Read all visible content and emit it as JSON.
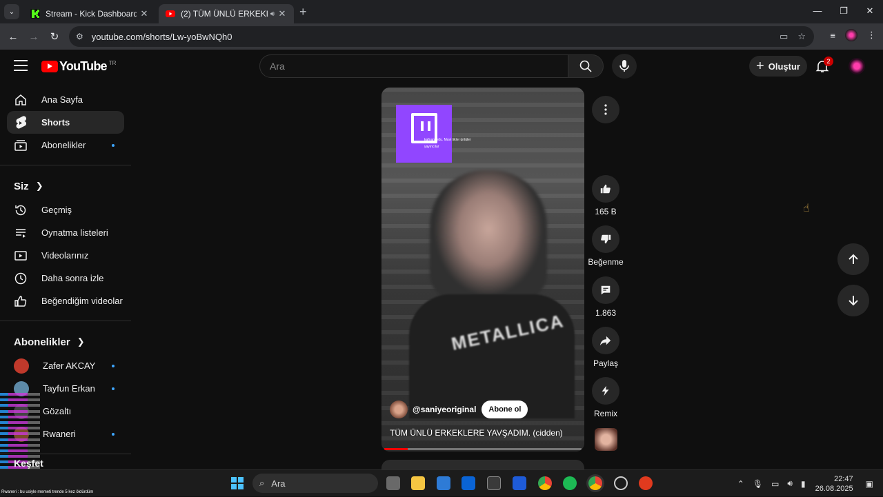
{
  "browser": {
    "tabs": [
      {
        "title": "Stream - Kick Dashboard",
        "active": false,
        "favicon": "kick-logo-icon"
      },
      {
        "title": "(2) TÜM ÜNLÜ ERKEKLERE Y",
        "active": true,
        "favicon": "youtube-icon",
        "audio": true
      }
    ],
    "url": "youtube.com/shorts/Lw-yoBwNQh0"
  },
  "youtube": {
    "logo_text": "YouTube",
    "region": "TR",
    "search_placeholder": "Ara",
    "create_label": "Oluştur",
    "notification_count": "2"
  },
  "sidebar": {
    "main": [
      {
        "label": "Ana Sayfa",
        "icon": "home-icon"
      },
      {
        "label": "Shorts",
        "icon": "shorts-icon",
        "active": true
      },
      {
        "label": "Abonelikler",
        "icon": "subscriptions-icon",
        "dot": true
      }
    ],
    "you_header": "Siz",
    "you": [
      {
        "label": "Geçmiş",
        "icon": "history-icon"
      },
      {
        "label": "Oynatma listeleri",
        "icon": "playlists-icon"
      },
      {
        "label": "Videolarınız",
        "icon": "your-videos-icon"
      },
      {
        "label": "Daha sonra izle",
        "icon": "watch-later-icon"
      },
      {
        "label": "Beğendiğim videolar",
        "icon": "liked-videos-icon"
      }
    ],
    "subs_header": "Abonelikler",
    "subs": [
      {
        "label": "Zafer AKCAY",
        "dot": true,
        "color": "#c0392b"
      },
      {
        "label": "Tayfun Erkan",
        "dot": true,
        "color": "#5d8aa8"
      },
      {
        "label": "Gözaltı",
        "dot": false,
        "color": "#444444"
      },
      {
        "label": "Rwaneri",
        "dot": true,
        "color": "#7a4a2a"
      }
    ],
    "explore_header": "Keşfet"
  },
  "short": {
    "channel": "@saniyeoriginal",
    "subscribe_label": "Abone ol",
    "title": "TÜM ÜNLÜ ERKEKLERE YAVŞADIM. (cidden)",
    "progress": 0.12,
    "overlay_caption": "kafnanoydu. Mavi tikler ünlüler",
    "overlay_caption2": "yayıncılar",
    "shirt_text": "METALLICA"
  },
  "actions": {
    "likes": "165 B",
    "dislike_label": "Beğenme",
    "comments": "1.863",
    "share_label": "Paylaş",
    "remix_label": "Remix"
  },
  "chat": {
    "message": "Rwaneri : bu usiyle memeti trende 5 kez öldürdüm"
  },
  "taskbar": {
    "search_placeholder": "Ara",
    "time": "22:47",
    "date": "26.08.2025"
  },
  "colors": {
    "accent": "#ff0000",
    "link_dot": "#3ea6ff",
    "twitch": "#9146ff"
  }
}
